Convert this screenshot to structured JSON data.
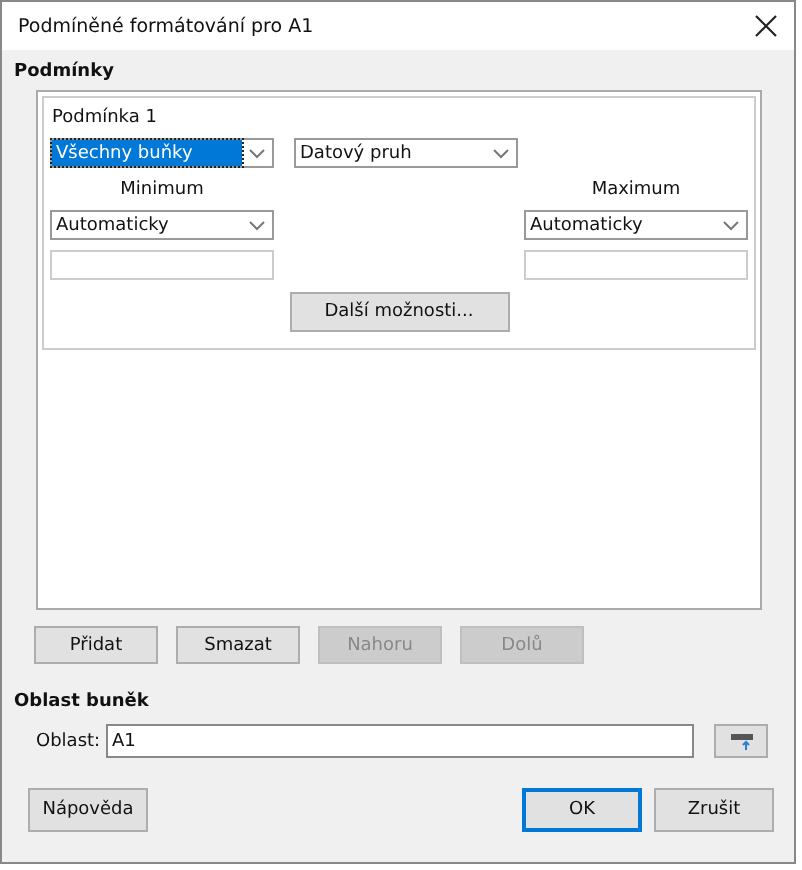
{
  "window": {
    "title": "Podmíněné formátování pro A1"
  },
  "conditions": {
    "heading": "Podmínky",
    "condition": {
      "label": "Podmínka 1",
      "type_select": {
        "value": "Všechny buňky",
        "selected": true
      },
      "style_select": {
        "value": "Datový pruh",
        "selected": false
      },
      "minimum": {
        "label": "Minimum",
        "select": "Automaticky"
      },
      "maximum": {
        "label": "Maximum",
        "select": "Automaticky"
      },
      "more_button": "Další možnosti..."
    }
  },
  "list_buttons": [
    {
      "label": "Přidat",
      "disabled": false
    },
    {
      "label": "Smazat",
      "disabled": false
    },
    {
      "label": "Nahoru",
      "disabled": true
    },
    {
      "label": "Dolů",
      "disabled": true
    }
  ],
  "cell_range": {
    "heading": "Oblast buněk",
    "label": "Oblast:",
    "value": "A1"
  },
  "help_button": {
    "label": "Nápověda",
    "default": false
  },
  "dialog_buttons": [
    {
      "label": "OK",
      "default": true
    },
    {
      "label": "Zrušit",
      "default": false
    }
  ]
}
